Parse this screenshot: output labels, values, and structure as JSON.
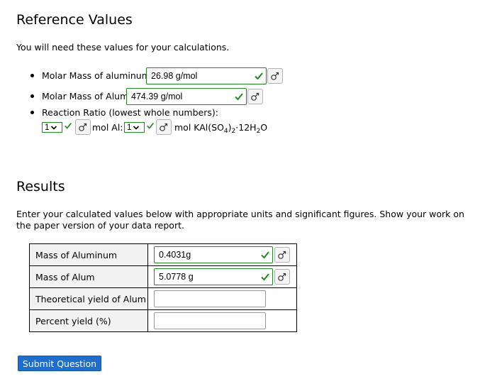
{
  "reference": {
    "title": "Reference Values",
    "intro": "You will need these values for your calculations.",
    "molar_mass_al": {
      "label": "Molar Mass of aluminum:",
      "value": "26.98 g/mol"
    },
    "molar_mass_alum": {
      "label": "Molar Mass of Alum:",
      "value": "474.39 g/mol"
    },
    "ratio": {
      "label": "Reaction Ratio (lowest whole numbers):",
      "al_value": "1",
      "al_unit": "mol Al:",
      "alum_value": "1",
      "alum_unit_prefix": "mol KAl(SO",
      "sub_4": "4",
      "paren_close": ")",
      "sub_2": "2",
      "dot_water": "·12H",
      "sub_2b": "2",
      "oxygen": "O"
    }
  },
  "results": {
    "title": "Results",
    "instructions": "Enter your calculated values below with appropriate units and significant figures. Show your work on the paper version of your data report.",
    "rows": [
      {
        "label": "Mass of Aluminum",
        "value": "0.4031g"
      },
      {
        "label": "Mass of Alum",
        "value": "5.0778 g"
      },
      {
        "label": "Theoretical yield of Alum",
        "value": ""
      },
      {
        "label": "Percent yield (%)",
        "value": ""
      }
    ]
  },
  "submit_label": "Submit Question",
  "colors": {
    "correct": "#1f8a1f",
    "submit": "#1c6fcf"
  },
  "icons": {
    "correct": "check-icon",
    "equation": "equation-editor-icon",
    "dropdown": "chevron-down-icon"
  }
}
